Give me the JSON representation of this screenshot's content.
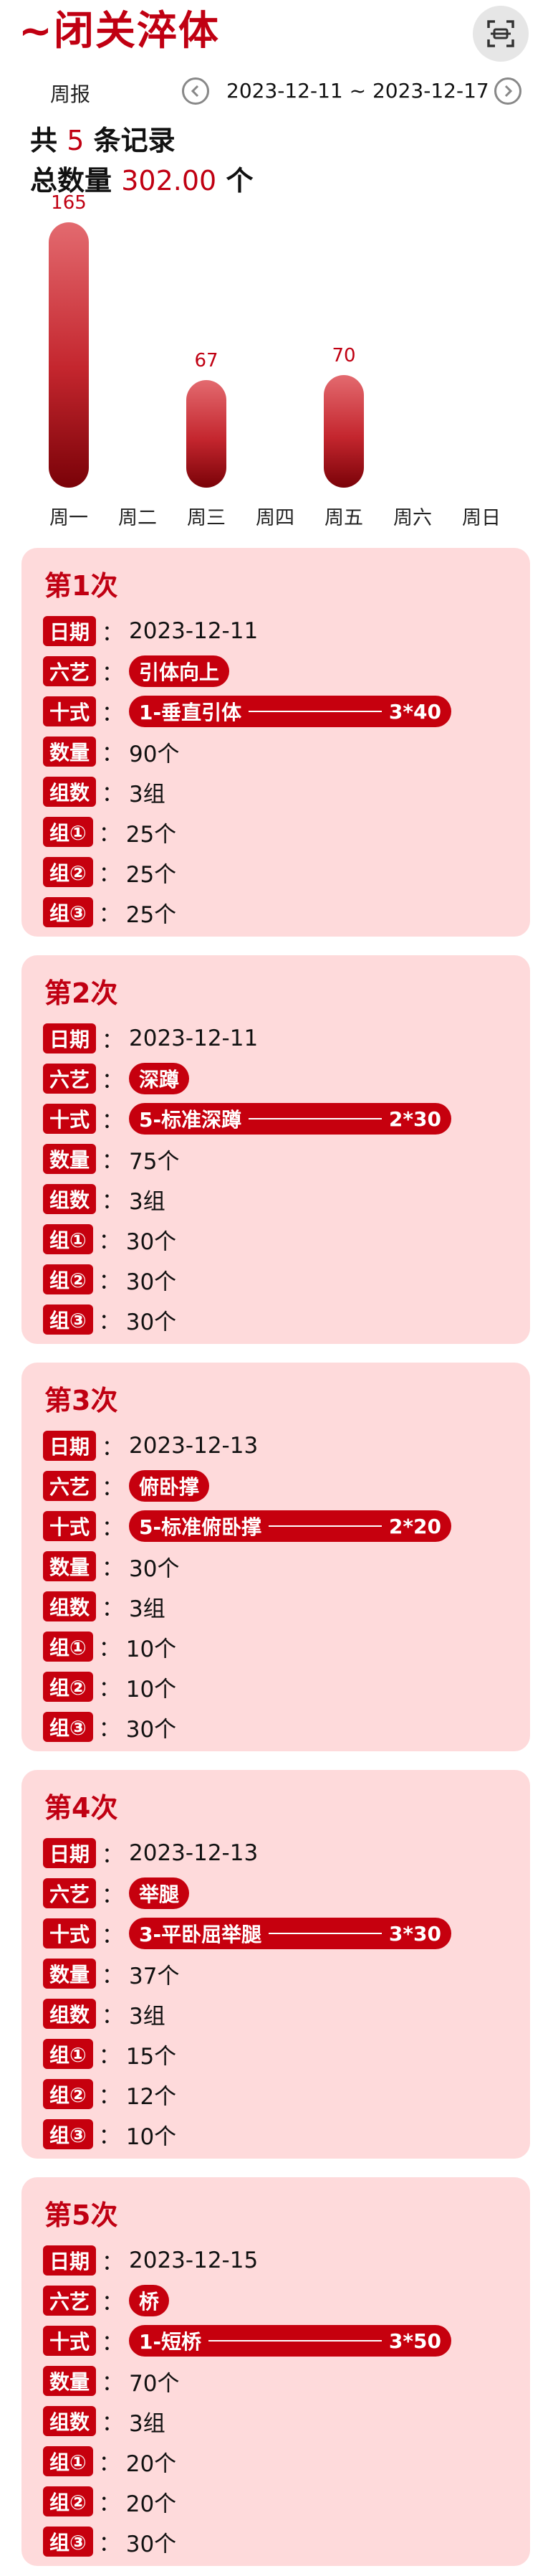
{
  "header": {
    "title": "~闭关淬体",
    "scan_icon": "scan-icon"
  },
  "week": {
    "mode": "周报",
    "date_range": "2023-12-11 ~ 2023-12-17"
  },
  "summary": {
    "count_prefix": "共",
    "count": "5",
    "count_suffix": "条记录",
    "total_prefix": "总数量",
    "total": "302.00",
    "total_suffix": "个"
  },
  "chart_data": {
    "type": "bar",
    "categories": [
      "周一",
      "周二",
      "周三",
      "周四",
      "周五",
      "周六",
      "周日"
    ],
    "values": [
      165,
      0,
      67,
      0,
      70,
      0,
      0
    ],
    "value_labels": [
      "165",
      "",
      "67",
      "",
      "70",
      "",
      ""
    ],
    "color": "#c6000e"
  },
  "field_labels": {
    "date": "日期",
    "art": "六艺",
    "form": "十式",
    "qty": "数量",
    "groups": "组数",
    "g1": "组①",
    "g2": "组②",
    "g3": "组③",
    "colon": "："
  },
  "records": [
    {
      "title": "第1次",
      "date": "2023-12-11",
      "art": "引体向上",
      "form": "1-垂直引体",
      "scheme": "3*40",
      "qty": "90个",
      "groups": "3组",
      "g1": "25个",
      "g2": "25个",
      "g3": "25个"
    },
    {
      "title": "第2次",
      "date": "2023-12-11",
      "art": "深蹲",
      "form": "5-标准深蹲",
      "scheme": "2*30",
      "qty": "75个",
      "groups": "3组",
      "g1": "30个",
      "g2": "30个",
      "g3": "30个"
    },
    {
      "title": "第3次",
      "date": "2023-12-13",
      "art": "俯卧撑",
      "form": "5-标准俯卧撑",
      "scheme": "2*20",
      "qty": "30个",
      "groups": "3组",
      "g1": "10个",
      "g2": "10个",
      "g3": "30个"
    },
    {
      "title": "第4次",
      "date": "2023-12-13",
      "art": "举腿",
      "form": "3-平卧屈举腿",
      "scheme": "3*30",
      "qty": "37个",
      "groups": "3组",
      "g1": "15个",
      "g2": "12个",
      "g3": "10个"
    },
    {
      "title": "第5次",
      "date": "2023-12-15",
      "art": "桥",
      "form": "1-短桥",
      "scheme": "3*50",
      "qty": "70个",
      "groups": "3组",
      "g1": "20个",
      "g2": "20个",
      "g3": "30个"
    }
  ]
}
